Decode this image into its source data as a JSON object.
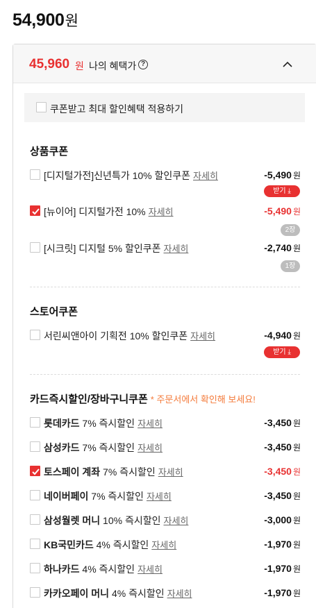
{
  "header": {
    "price": "54,900",
    "won": "원"
  },
  "benefit": {
    "price": "45,960",
    "won": "원",
    "label": "나의 혜택가",
    "info_glyph": "?"
  },
  "max_benefit": {
    "label": "쿠폰받고 최대 할인혜택 적용하기"
  },
  "sections": {
    "product": {
      "title": "상품쿠폰"
    },
    "store": {
      "title": "스토어쿠폰"
    },
    "card": {
      "title": "카드즉시할인/장바구니쿠폰",
      "note": "* 주문서에서 확인해 보세요!"
    }
  },
  "product_coupons": [
    {
      "name": "[디지털가전]신년특가 10% 할인쿠폰",
      "detail": "자세히",
      "amount": "-5,490",
      "won": "원",
      "badge": "받기 ⤓"
    },
    {
      "name": "[뉴이어] 디지털가전 10%",
      "detail": "자세히",
      "amount": "-5,490",
      "won": "원",
      "badge": "2장"
    },
    {
      "name": "[시크릿] 디지털 5% 할인쿠폰",
      "detail": "자세히",
      "amount": "-2,740",
      "won": "원",
      "badge": "1장"
    }
  ],
  "store_coupons": [
    {
      "name": "서린씨앤아이 기획전 10% 할인쿠폰",
      "detail": "자세히",
      "amount": "-4,940",
      "won": "원",
      "badge": "받기 ⤓"
    }
  ],
  "card_discounts": [
    {
      "brand": "롯데카드",
      "rest": " 7% 즉시할인",
      "detail": "자세히",
      "amount": "-3,450",
      "won": "원"
    },
    {
      "brand": "삼성카드",
      "rest": " 7% 즉시할인",
      "detail": "자세히",
      "amount": "-3,450",
      "won": "원"
    },
    {
      "brand": "토스페이 계좌",
      "rest": " 7% 즉시할인",
      "detail": "자세히",
      "amount": "-3,450",
      "won": "원"
    },
    {
      "brand": "네이버페이",
      "rest": " 7% 즉시할인",
      "detail": "자세히",
      "amount": "-3,450",
      "won": "원"
    },
    {
      "brand": "삼성월렛 머니",
      "rest": " 10% 즉시할인",
      "detail": "자세히",
      "amount": "-3,000",
      "won": "원"
    },
    {
      "brand": "KB국민카드",
      "rest": " 4% 즉시할인",
      "detail": "자세히",
      "amount": "-1,970",
      "won": "원"
    },
    {
      "brand": "하나카드",
      "rest": " 4% 즉시할인",
      "detail": "자세히",
      "amount": "-1,970",
      "won": "원"
    },
    {
      "brand": "카카오페이 머니",
      "rest": " 4% 즉시할인",
      "detail": "자세히",
      "amount": "-1,970",
      "won": "원"
    }
  ],
  "colors": {
    "accent": "#e83131",
    "note": "#f47a3a",
    "badge_gray": "#bdbdbd"
  }
}
